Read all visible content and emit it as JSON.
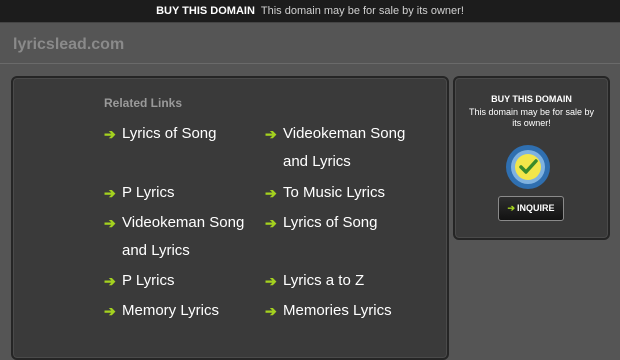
{
  "topbar": {
    "bold_text": "BUY THIS DOMAIN",
    "message": "This domain may be for sale by its owner!"
  },
  "site": {
    "domain": "lyricslead.com"
  },
  "related": {
    "heading": "Related Links",
    "arrow": "➔",
    "left_links": [
      "Lyrics of Song",
      "P Lyrics",
      "Videokeman Song and Lyrics",
      "P Lyrics",
      "Memory Lyrics"
    ],
    "right_links": [
      "Videokeman Song and Lyrics",
      "To Music Lyrics",
      "Lyrics of Song",
      "Lyrics a to Z",
      "Memories Lyrics"
    ]
  },
  "sidebar": {
    "title": "BUY THIS DOMAIN",
    "description": "This domain may be for sale by its owner!",
    "inquire_label": "INQUIRE",
    "inquire_arrow": "➔",
    "seal_icon": "safe-buyer-seal-icon"
  },
  "colors": {
    "accent": "#a4d21f",
    "background": "#555555",
    "panel": "#3a3a3a",
    "topbar": "#1c1c1c"
  }
}
